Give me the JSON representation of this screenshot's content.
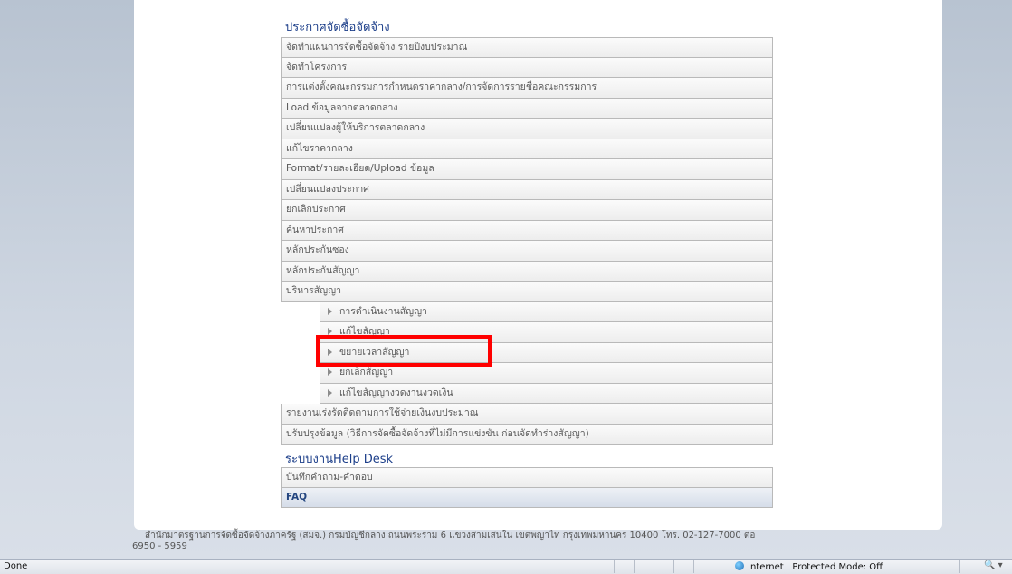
{
  "sections": {
    "procurement": {
      "title": "ประกาศจัดซื้อจัดจ้าง",
      "items": [
        "จัดทำแผนการจัดซื้อจัดจ้าง รายปีงบประมาณ",
        "จัดทำโครงการ",
        "การแต่งตั้งคณะกรรมการกำหนดราคากลาง/การจัดการรายชื่อคณะกรรมการ",
        "Load ข้อมูลจากตลาดกลาง",
        "เปลี่ยนแปลงผู้ให้บริการตลาดกลาง",
        "แก้ไขราคากลาง",
        "Format/รายละเอียด/Upload ข้อมูล",
        "เปลี่ยนแปลงประกาศ",
        "ยกเลิกประกาศ",
        "ค้นหาประกาศ",
        "หลักประกันซอง",
        "หลักประกันสัญญา",
        "บริหารสัญญา"
      ],
      "contract_subitems": [
        "การดำเนินงานสัญญา",
        "แก้ไขสัญญา",
        "ขยายเวลาสัญญา",
        "ยกเลิกสัญญา",
        "แก้ไขสัญญางวดงานงวดเงิน"
      ],
      "items_after": [
        "รายงานเร่งรัดติดตามการใช้จ่ายเงินงบประมาณ",
        "ปรับปรุงข้อมูล (วิธีการจัดซื้อจัดจ้างที่ไม่มีการแข่งขัน ก่อนจัดทำร่างสัญญา)"
      ]
    },
    "helpdesk": {
      "title": "ระบบงานHelp Desk",
      "items": [
        "บันทึกคำถาม-คำตอบ",
        "FAQ"
      ]
    }
  },
  "footer": {
    "line1": "สำนักมาตรฐานการจัดซื้อจัดจ้างภาครัฐ (สมจ.) กรมบัญชีกลาง ถนนพระราม 6 แขวงสามเสนใน เขตพญาไท กรุงเทพมหานคร 10400 โทร. 02-127-7000 ต่อ",
    "line2": "6950 - 5959"
  },
  "statusbar": {
    "status": "Done",
    "zone": "Internet | Protected Mode: Off",
    "zoom": "🔍 ▾"
  },
  "colors": {
    "highlight": "#ff0000",
    "title": "#1d3f8a"
  },
  "icons": {
    "bullet": "triangle-right-icon",
    "zone": "globe-icon"
  }
}
